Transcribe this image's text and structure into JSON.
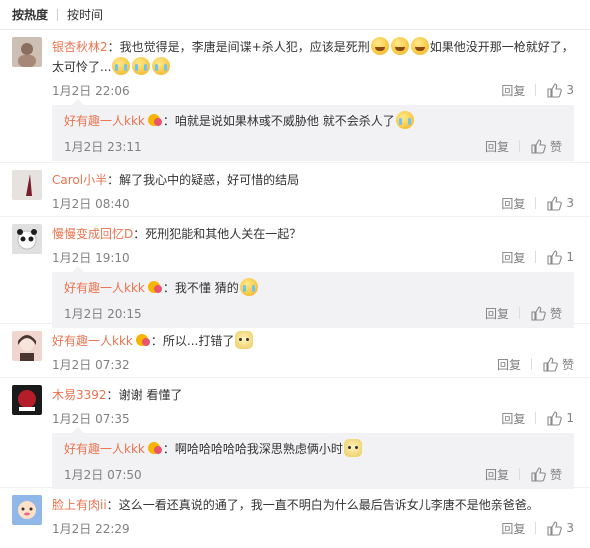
{
  "sort_tabs": [
    {
      "label": "按热度",
      "active": true
    },
    {
      "label": "按时间",
      "active": false
    }
  ],
  "actions": {
    "reply_label": "回复",
    "like_label": "赞"
  },
  "comments": [
    {
      "user": "银杏秋林2",
      "text_a": "我也觉得是，李唐是间谍+杀人犯，应该是死刑",
      "text_b": "如果他没开那一枪就好了，太可怜了...",
      "time": "1月2日 22:06",
      "likes": "3",
      "avatar_colors": [
        "#c9b7a8",
        "#8a6e5e"
      ],
      "reply": {
        "user": "好有趣一人kkk",
        "text": "咱就是说如果林彧不威胁他 就不会杀人了",
        "time": "1月2日 23:11",
        "likes": "赞"
      }
    },
    {
      "user": "Carol小半",
      "text_a": "解了我心中的疑惑，好可惜的结局",
      "time": "1月2日 08:40",
      "likes": "3",
      "avatar_colors": [
        "#e6e2e0",
        "#7a1f2a"
      ]
    },
    {
      "user": "慢慢变成回忆D",
      "text_a": "死刑犯能和其他人关在一起？",
      "time": "1月2日 19:10",
      "likes": "1",
      "avatar_colors": [
        "#dcdcdc",
        "#1e1e1e"
      ],
      "reply": {
        "user": "好有趣一人kkk",
        "text": "我不懂 猜的",
        "time": "1月2日 20:15",
        "likes": "赞"
      }
    },
    {
      "user": "好有趣一人kkk",
      "text_a": "所以...打错了",
      "time": "1月2日 07:32",
      "likes": "赞",
      "avatar_colors": [
        "#f0d6cf",
        "#4a3430"
      ]
    },
    {
      "user": "木易3392",
      "text_a": "谢谢 看懂了",
      "time": "1月2日 07:35",
      "likes": "1",
      "avatar_colors": [
        "#b51d2a",
        "#1a1a1a"
      ],
      "reply": {
        "user": "好有趣一人kkk",
        "text": "啊哈哈哈哈哈我深思熟虑俩小时",
        "time": "1月2日 07:50",
        "likes": "赞"
      }
    },
    {
      "user": "脸上有肉ii",
      "text_a": "这么一看还真说的通了，我一直不明白为什么最后告诉女儿李唐不是他亲爸爸。",
      "time": "1月2日 22:29",
      "likes": "3",
      "avatar_colors": [
        "#8fb7e8",
        "#e86a8a"
      ]
    }
  ]
}
